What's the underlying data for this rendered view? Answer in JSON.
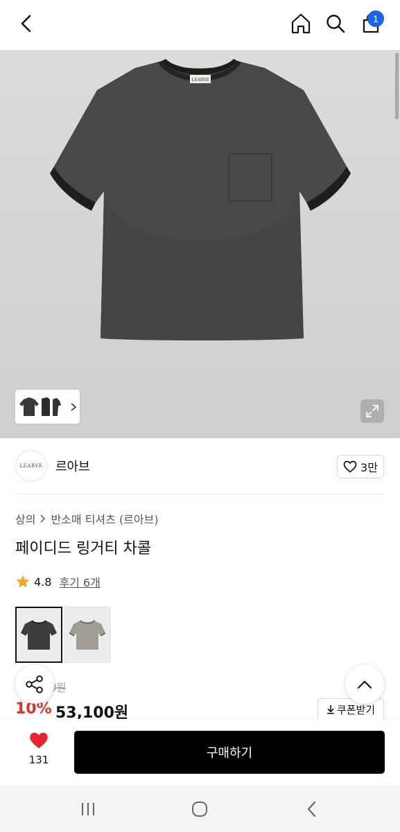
{
  "topbar": {
    "back_icon": "chevron-left-icon",
    "home_icon": "home-icon",
    "search_icon": "search-icon",
    "cart_icon": "shopping-bag-icon",
    "cart_count": "1"
  },
  "hero": {
    "product_image": "gray ringer t-shirt with chest pocket",
    "tag_text": "LEARVE",
    "expand_icon": "expand-icon",
    "thumb_arrow_icon": "chevron-right-icon"
  },
  "brand": {
    "logo_text": "LEARVE",
    "name": "르아브",
    "like_count": "3만",
    "like_icon": "heart-outline-icon"
  },
  "breadcrumb": {
    "items": [
      "상의",
      "반소매 티셔츠 (르아브)"
    ],
    "separator_icon": "chevron-right-icon"
  },
  "product": {
    "title": "페이디드 링거티 차콜",
    "rating": "4.8",
    "reviews": "후기 6개",
    "star_icon": "star-icon",
    "colors": [
      "#3f3d3b",
      "#a19d95"
    ],
    "original_price_fragment": "0원",
    "discount": "10%",
    "price": "53,100원"
  },
  "coupon": {
    "label": "쿠폰받기",
    "icon": "download-icon"
  },
  "floating": {
    "share_icon": "share-icon",
    "scroll_top_icon": "chevron-up-icon"
  },
  "buybar": {
    "heart_count": "131",
    "heart_icon": "heart-filled-icon",
    "heart_color": "#e8242c",
    "buy_label": "구매하기"
  },
  "sysnav": {
    "recent_icon": "recent-apps-icon",
    "home_icon": "home-circle-icon",
    "back_icon": "back-icon"
  }
}
